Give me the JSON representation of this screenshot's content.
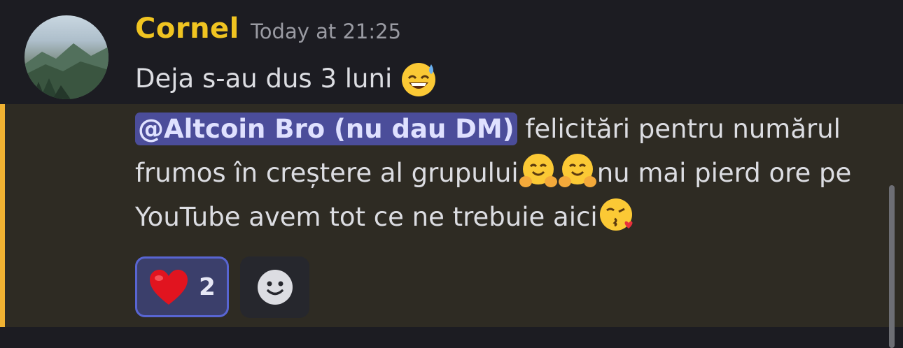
{
  "message": {
    "author": "Cornel",
    "timestamp": "Today at 21:25",
    "text_line1": "Deja s-au dus 3 luni",
    "mention": "@Altcoin Bro (nu dau DM)",
    "text_part1": " felicitări pentru numărul frumos în creștere al grupului",
    "text_part2": "nu mai pierd ore pe YouTube avem tot ce ne trebuie aici",
    "emojis": {
      "line1": "grinning-sweat-emoji",
      "hug": "hugging-face-emoji",
      "kiss": "face-blowing-kiss-emoji"
    }
  },
  "reactions": [
    {
      "emoji": "red-heart",
      "count": "2"
    }
  ],
  "colors": {
    "author": "#f0c421",
    "highlight_bar": "#f0b232",
    "mention_bg": "#4b4d9a",
    "reaction_border": "#5865d2"
  }
}
